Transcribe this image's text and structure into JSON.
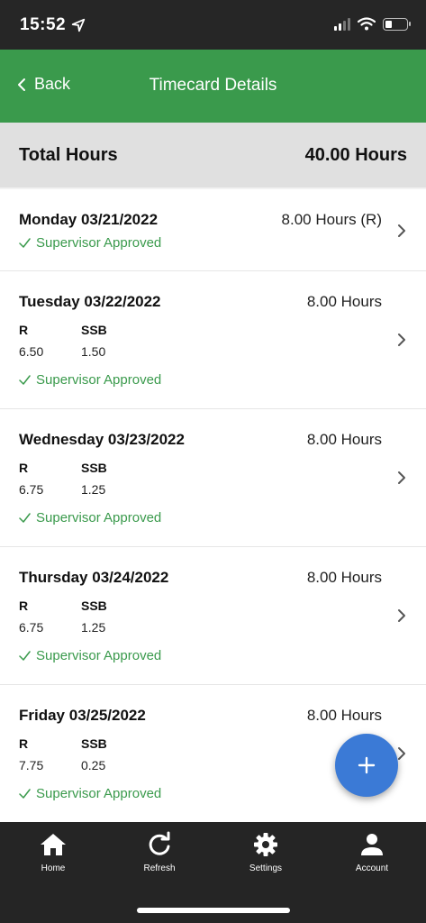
{
  "status_bar": {
    "time": "15:52"
  },
  "header": {
    "back_label": "Back",
    "title": "Timecard Details"
  },
  "total": {
    "label": "Total Hours",
    "value": "40.00 Hours"
  },
  "days": [
    {
      "date": "Monday 03/21/2022",
      "hours": "8.00 Hours (R)",
      "status": "Supervisor Approved",
      "codes": []
    },
    {
      "date": "Tuesday 03/22/2022",
      "hours": "8.00 Hours",
      "status": "Supervisor Approved",
      "codes": [
        {
          "code": "R",
          "value": "6.50"
        },
        {
          "code": "SSB",
          "value": "1.50"
        }
      ]
    },
    {
      "date": "Wednesday 03/23/2022",
      "hours": "8.00 Hours",
      "status": "Supervisor Approved",
      "codes": [
        {
          "code": "R",
          "value": "6.75"
        },
        {
          "code": "SSB",
          "value": "1.25"
        }
      ]
    },
    {
      "date": "Thursday 03/24/2022",
      "hours": "8.00 Hours",
      "status": "Supervisor Approved",
      "codes": [
        {
          "code": "R",
          "value": "6.75"
        },
        {
          "code": "SSB",
          "value": "1.25"
        }
      ]
    },
    {
      "date": "Friday 03/25/2022",
      "hours": "8.00 Hours",
      "status": "Supervisor Approved",
      "codes": [
        {
          "code": "R",
          "value": "7.75"
        },
        {
          "code": "SSB",
          "value": "0.25"
        }
      ]
    }
  ],
  "tabs": [
    {
      "label": "Home",
      "icon": "home-icon"
    },
    {
      "label": "Refresh",
      "icon": "refresh-icon"
    },
    {
      "label": "Settings",
      "icon": "gear-icon"
    },
    {
      "label": "Account",
      "icon": "person-icon"
    }
  ],
  "colors": {
    "header": "#3a9a4c",
    "approved": "#3a9a4c",
    "fab": "#3b7ad6",
    "tabbar": "#252525"
  }
}
